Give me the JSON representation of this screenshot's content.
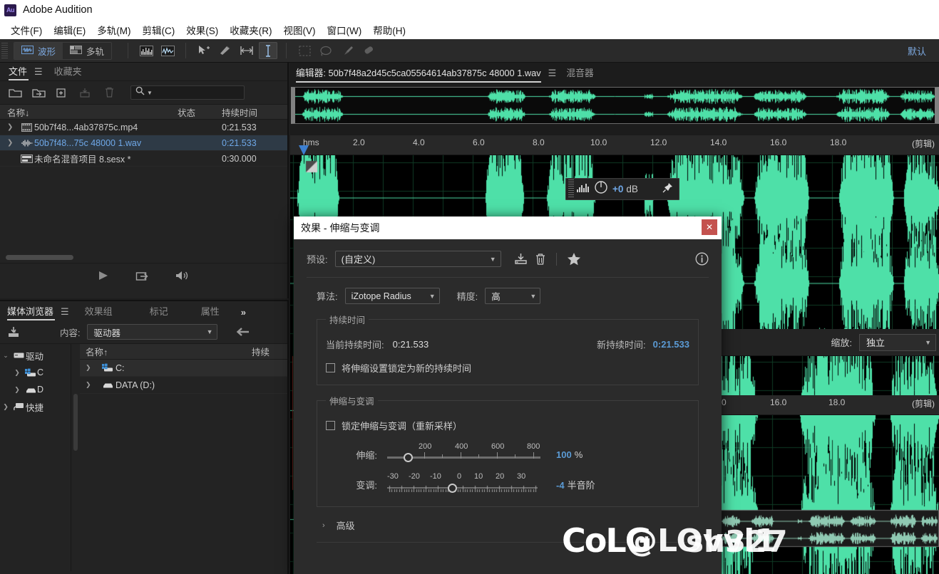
{
  "titlebar": {
    "logo": "Au",
    "app_title": "Adobe Audition"
  },
  "menubar": {
    "items": [
      {
        "label": "文件(F)"
      },
      {
        "label": "编辑(E)"
      },
      {
        "label": "多轨(M)"
      },
      {
        "label": "剪辑(C)"
      },
      {
        "label": "效果(S)"
      },
      {
        "label": "收藏夹(R)"
      },
      {
        "label": "视图(V)"
      },
      {
        "label": "窗口(W)"
      },
      {
        "label": "帮助(H)"
      }
    ]
  },
  "toolbar": {
    "waveform_mode": "波形",
    "multitrack_mode": "多轨",
    "workspace": "默认",
    "tools": [
      {
        "name": "spectral-frequency-icon"
      },
      {
        "name": "spectral-pitch-icon"
      },
      {
        "name": "move-tool-icon"
      },
      {
        "name": "razor-tool-icon"
      },
      {
        "name": "slip-tool-icon"
      },
      {
        "name": "time-selection-tool-icon"
      },
      {
        "name": "marquee-selection-icon"
      },
      {
        "name": "lasso-selection-icon"
      },
      {
        "name": "paintbrush-selection-icon"
      },
      {
        "name": "spot-healing-brush-icon"
      }
    ]
  },
  "files_panel": {
    "tabs": [
      {
        "label": "文件",
        "active": true
      },
      {
        "label": "收藏夹",
        "active": false
      }
    ],
    "search_placeholder": "",
    "columns": {
      "name": "名称",
      "name_sort": "↓",
      "status": "状态",
      "duration": "持续时间"
    },
    "rows": [
      {
        "name": "50b7f48...4ab37875c.mp4",
        "status": "",
        "duration": "0:21.533",
        "icon": "video-file-icon",
        "selected": false
      },
      {
        "name": "50b7f48...75c 48000 1.wav",
        "status": "",
        "duration": "0:21.533",
        "icon": "audio-file-icon",
        "selected": true
      },
      {
        "name": "未命名混音项目 8.sesx *",
        "status": "",
        "duration": "0:30.000",
        "icon": "session-file-icon",
        "selected": false
      }
    ]
  },
  "media_panel": {
    "tabs": [
      {
        "label": "媒体浏览器",
        "active": true
      },
      {
        "label": "效果组",
        "active": false
      },
      {
        "label": "标记",
        "active": false
      },
      {
        "label": "属性",
        "active": false
      }
    ],
    "overflow": "»",
    "content_label": "内容:",
    "content_value": "驱动器",
    "tree": [
      {
        "label": "驱动",
        "icon": "drives-icon",
        "expanded": true,
        "indent": 0
      },
      {
        "label": "C",
        "icon": "windows-drive-icon",
        "expanded": false,
        "indent": 1
      },
      {
        "label": "D",
        "icon": "drive-icon",
        "expanded": false,
        "indent": 1
      },
      {
        "label": "快捷",
        "icon": "shortcuts-icon",
        "expanded": false,
        "indent": 0
      }
    ],
    "columns": {
      "name": "名称",
      "name_sort": "↑",
      "duration": "持续"
    },
    "rows": [
      {
        "name": "C:",
        "icon": "windows-drive-icon",
        "selected": true
      },
      {
        "name": "DATA (D:)",
        "icon": "drive-icon",
        "selected": false
      }
    ]
  },
  "editor": {
    "tabs": [
      {
        "label": "编辑器: 50b7f48a2d45c5ca05564614ab37875c 48000 1.wav",
        "active": true
      },
      {
        "label": "混音器",
        "active": false
      }
    ],
    "ruler": {
      "origin_label": "hms",
      "ticks": [
        "2.0",
        "4.0",
        "6.0",
        "8.0",
        "10.0",
        "12.0",
        "14.0",
        "16.0",
        "18.0"
      ],
      "clip_label": "(剪辑)"
    },
    "ruler2": {
      "ticks": [
        "0",
        "16.0",
        "18.0"
      ],
      "clip_label": "(剪辑)"
    },
    "gain_widget": {
      "value": "+0",
      "unit": "dB",
      "pin": "pin-icon"
    },
    "zoom_strip": {
      "label": "缩放:",
      "value": "独立"
    }
  },
  "dialog": {
    "title": "效果 - 伸缩与变调",
    "close": "✕",
    "preset_label": "预设:",
    "preset_value": "(自定义)",
    "preset_icons": [
      "save-preset-icon",
      "delete-preset-icon",
      "favorite-star-icon",
      "info-icon"
    ],
    "algorithm_label": "算法:",
    "algorithm_value": "iZotope Radius",
    "precision_label": "精度:",
    "precision_value": "高",
    "duration_group": {
      "legend": "持续时间",
      "current_label": "当前持续时间:",
      "current_value": "0:21.533",
      "new_label": "新持续时间:",
      "new_value": "0:21.533",
      "lock_checkbox_label": "将伸缩设置锁定为新的持续时间",
      "lock_checked": false
    },
    "stretch_group": {
      "legend": "伸缩与变调",
      "lock_checkbox_label": "锁定伸缩与变调（重新采样）",
      "lock_checked": false,
      "stretch": {
        "label": "伸缩:",
        "ticks": [
          "200",
          "400",
          "600",
          "800"
        ],
        "value": "100",
        "unit": "%",
        "knob_pct": 12
      },
      "pitch": {
        "label": "变调:",
        "ticks": [
          "-30",
          "-20",
          "-10",
          "0",
          "10",
          "20",
          "30"
        ],
        "value": "-4",
        "unit": "半音阶",
        "knob_pct": 43
      }
    },
    "advanced_label": "高级",
    "advanced_twisty": "›"
  },
  "watermark": {
    "line1": "CoLG",
    "line2": "@LOvvl1",
    "line3": "sh327"
  },
  "colors": {
    "accent_blue": "#5b9bd5",
    "waveform_green": "#4ee0a8",
    "close_red": "#c4524f",
    "selection_blue": "#2e3a46"
  }
}
